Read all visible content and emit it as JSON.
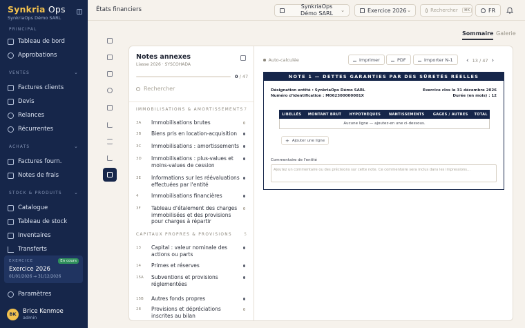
{
  "sidebar": {
    "brand_name": "Synkria",
    "brand_suffix": "Ops",
    "brand_sub": "SynkriaOps Démo SARL",
    "sections": [
      {
        "label": "Principal",
        "items": [
          {
            "label": "Tableau de bord",
            "icon": "grid-icon"
          },
          {
            "label": "Approbations",
            "icon": "check-icon"
          }
        ]
      },
      {
        "label": "Ventes",
        "items": [
          {
            "label": "Factures clients",
            "icon": "invoice-icon"
          },
          {
            "label": "Devis",
            "icon": "quote-icon"
          },
          {
            "label": "Relances",
            "icon": "bell-icon"
          },
          {
            "label": "Récurrentes",
            "icon": "repeat-icon"
          }
        ]
      },
      {
        "label": "Achats",
        "items": [
          {
            "label": "Factures fourn.",
            "icon": "invoice-icon"
          },
          {
            "label": "Notes de frais",
            "icon": "receipt-icon"
          }
        ]
      },
      {
        "label": "Stock & produits",
        "items": [
          {
            "label": "Catalogue",
            "icon": "tag-icon"
          },
          {
            "label": "Tableau de stock",
            "icon": "box-icon"
          },
          {
            "label": "Inventaires",
            "icon": "clipboard-icon"
          },
          {
            "label": "Transferts",
            "icon": "transfer-icon"
          }
        ]
      }
    ],
    "exercise": {
      "label": "EXERCICE",
      "badge": "En cours",
      "title": "Exercice 2026",
      "dates": "01/01/2026 → 31/12/2026"
    },
    "settings_label": "Paramètres",
    "user": {
      "initials": "BK",
      "name": "Brice Kenmoe",
      "role": "admin"
    }
  },
  "topbar": {
    "title": "États financiers",
    "company": "SynkriaOps Démo SARL",
    "exercise": "Exercice 2026",
    "search_placeholder": "Rechercher",
    "search_kbd": "⌘K",
    "lang": "FR"
  },
  "view_tabs": [
    {
      "label": "Sommaire"
    },
    {
      "label": "Galerie"
    }
  ],
  "notes": {
    "title": "Notes annexes",
    "subtitle": "Liasse 2026 · SYSCOHADA",
    "progress_done": "0",
    "progress_total": "/ 47",
    "progress_fraction": 0.0,
    "search_placeholder": "Rechercher",
    "groups": [
      {
        "label": "Immobilisations & amortissements",
        "count": "7",
        "items": [
          {
            "code": "3A",
            "label": "Immobilisations brutes",
            "done": false
          },
          {
            "code": "3B",
            "label": "Biens pris en location-acquisition",
            "done": true
          },
          {
            "code": "3C",
            "label": "Immobilisations : amortissements",
            "done": true
          },
          {
            "code": "3D",
            "label": "Immobilisations : plus-values et moins-values de cession",
            "done": true
          },
          {
            "code": "3E",
            "label": "Informations sur les réévaluations effectuées par l'entité",
            "done": true
          },
          {
            "code": "4",
            "label": "Immobilisations financières",
            "done": true
          },
          {
            "code": "3F",
            "label": "Tableau d'étalement des charges immobilisées et des provisions pour charges à répartir",
            "done": false
          }
        ]
      },
      {
        "label": "Capitaux propres & provisions",
        "count": "5",
        "items": [
          {
            "code": "13",
            "label": "Capital : valeur nominale des actions ou parts",
            "done": true
          },
          {
            "code": "14",
            "label": "Primes et réserves",
            "done": true
          },
          {
            "code": "15A",
            "label": "Subventions et provisions réglementées",
            "done": true
          },
          {
            "code": "15B",
            "label": "Autres fonds propres",
            "done": true
          },
          {
            "code": "28",
            "label": "Provisions et dépréciations inscrites au bilan",
            "done": false
          }
        ]
      }
    ]
  },
  "document": {
    "autocalc": "Auto-calculée",
    "print": "Imprimer",
    "pdf": "PDF",
    "import": "Importer N-1",
    "page_current": "13",
    "page_sep": "/",
    "page_total": "47",
    "heading": "NOTE 1 — DETTES GARANTIES PAR DES SÛRETÉS RÉELLES",
    "entity_line": "Désignation entité : SynkriaOps Démo SARL",
    "id_line": "Numéro d'identification : M062300000001X",
    "close_line": "Exercice clos le 31 décembre 2026",
    "duration_line": "Durée (en mois) : 12",
    "columns": [
      "LIBELLÉS",
      "MONTANT BRUT",
      "HYPOTHÈQUES",
      "NANTISSEMENTS",
      "GAGES / AUTRES",
      "TOTAL"
    ],
    "empty_row": "Aucune ligne — ajoutez-en une ci-dessous.",
    "add_line": "Ajouter une ligne",
    "comment_label": "Commentaire de l'entité",
    "comment_placeholder": "Ajoutez un commentaire ou des précisions sur cette note. Ce commentaire sera inclus dans les impressions..."
  }
}
